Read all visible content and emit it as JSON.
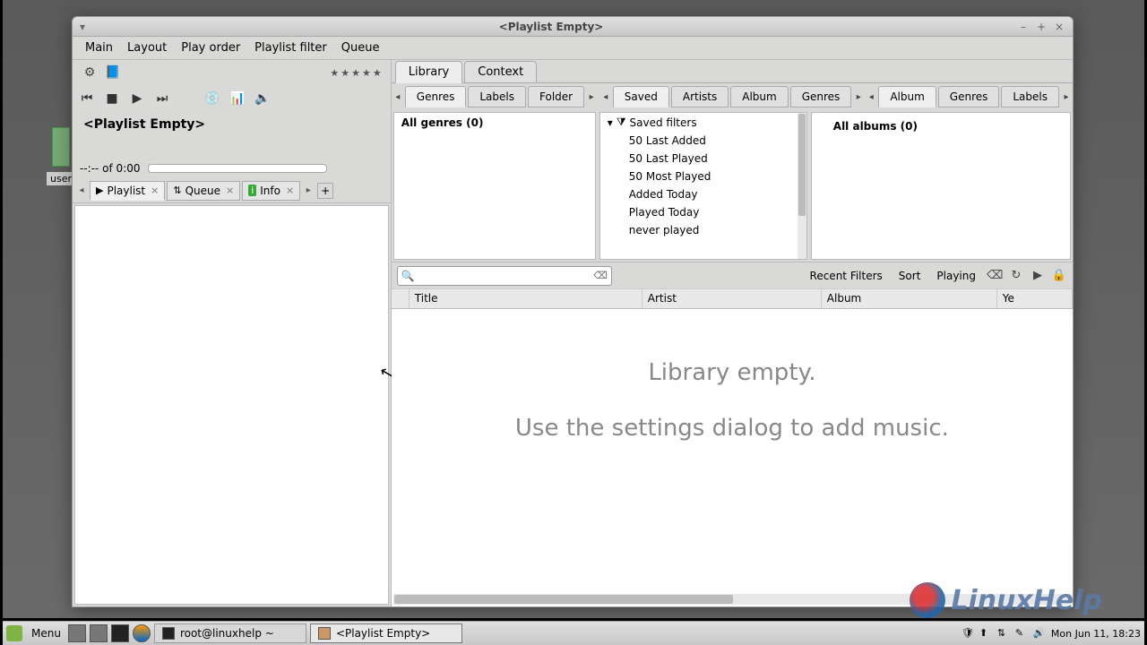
{
  "window": {
    "title": "<Playlist Empty>",
    "minimize": "–",
    "maximize": "+",
    "close": "×"
  },
  "menubar": [
    "Main",
    "Layout",
    "Play order",
    "Playlist filter",
    "Queue"
  ],
  "now_playing": "<Playlist Empty>",
  "time": "--:-- of 0:00",
  "panel_tabs": {
    "playlist": "Playlist",
    "queue": "Queue",
    "info": "Info"
  },
  "top_tabs": {
    "library": "Library",
    "context": "Context"
  },
  "left_browser": {
    "tabs": [
      "Genres",
      "Labels",
      "Folder"
    ],
    "header": "All genres (0)"
  },
  "mid_browser": {
    "tabs": [
      "Saved",
      "Artists",
      "Album",
      "Genres"
    ],
    "head": "Saved filters",
    "rows": [
      "50 Last Added",
      "50 Last Played",
      "50 Most Played",
      "Added Today",
      "Played Today",
      "never played"
    ]
  },
  "right_browser": {
    "tabs": [
      "Album",
      "Genres",
      "Labels"
    ],
    "header": "All albums (0)"
  },
  "filter_row": {
    "recent": "Recent Filters",
    "sort": "Sort",
    "playing": "Playing"
  },
  "table_headers": {
    "title": "Title",
    "artist": "Artist",
    "album": "Album",
    "year": "Ye"
  },
  "empty": {
    "line1": "Library empty.",
    "line2": "Use the settings dialog to add music."
  },
  "taskbar": {
    "menu": "Menu",
    "task1": "root@linuxhelp ~",
    "task2": "<Playlist Empty>",
    "clock": "Mon Jun 11, 18:23"
  },
  "desktop": {
    "user_label": "user"
  },
  "watermark": "LinuxHelp"
}
